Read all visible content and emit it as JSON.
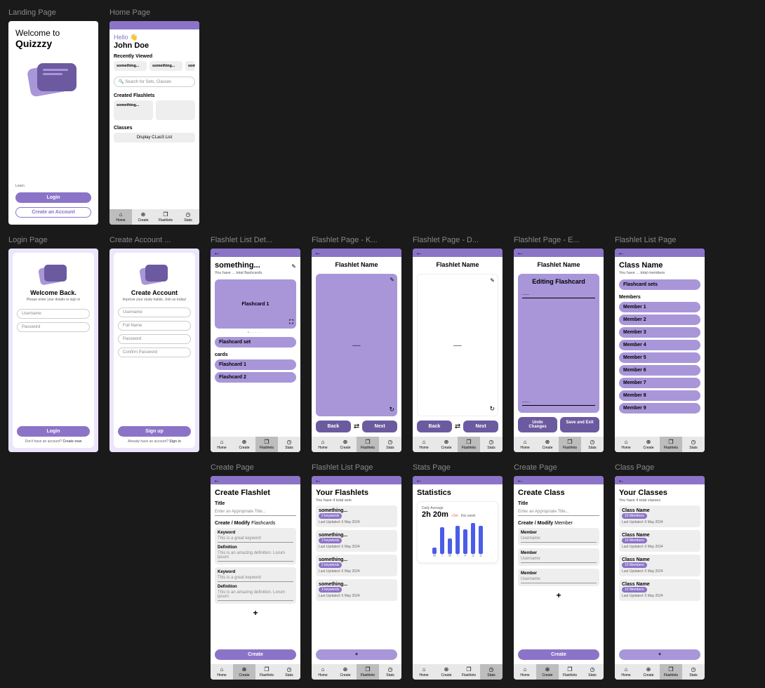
{
  "nav": {
    "home": "Home",
    "create": "Create",
    "flashlets": "Flashlets",
    "stats": "Stats"
  },
  "landing": {
    "label": "Landing Page",
    "welcome_to": "Welcome to",
    "brand": "Quizzzy",
    "login": "Login",
    "create_account": "Create an Account",
    "footnote": "Learn"
  },
  "home": {
    "label": "Home Page",
    "hello": "Hello 👋",
    "username": "John Doe",
    "recently_viewed": "Recently Viewed",
    "items": [
      "something...",
      "something...",
      "som"
    ],
    "search_placeholder": "Search for Sets, Classes",
    "created_flashlets": "Created Flashlets",
    "flashlet": "something...",
    "classes": "Classes",
    "display_class": "Display CLasS List"
  },
  "create_flashlet": {
    "label": "Create Page",
    "title": "Create Flashlet",
    "title_field": "Title",
    "title_placeholder": "Enter an Appropriate Title...",
    "section": "Create / Modify",
    "section_suffix": "Flashcards",
    "keyword": "Keyword",
    "keyword_val": "This is a great keyword",
    "definition": "Definition",
    "definition_val": "This is an amazing definition. Lorum ipsum",
    "create": "Create"
  },
  "flashlet_list": {
    "label": "Flashlet List Page",
    "title": "Your Flashlets",
    "subtitle": "You have 4 total sets",
    "item_name": "something...",
    "keyword_badge": "2 keywords",
    "updated": "Last Updated: 6 May 2024"
  },
  "stats": {
    "label": "Stats Page",
    "title": "Statistics",
    "avg_label": "Daily Average",
    "avg_value": "2h 20m",
    "delta": "+3m",
    "delta_label": "this week",
    "days": [
      "M",
      "T",
      "W",
      "T",
      "F",
      "S",
      "S"
    ],
    "chart_data": {
      "type": "bar",
      "categories": [
        "M",
        "T",
        "W",
        "T",
        "F",
        "S",
        "S"
      ],
      "values": [
        15,
        38,
        22,
        40,
        35,
        44,
        40
      ],
      "ylim": [
        0,
        50
      ],
      "title": "Daily Average"
    }
  },
  "create_class": {
    "label": "Create Page",
    "title": "Create Class",
    "title_field": "Title",
    "title_placeholder": "Enter an Appropriate Title...",
    "section": "Create / Modify",
    "section_suffix": "Member",
    "member": "Member",
    "member_placeholder": "Username",
    "create": "Create"
  },
  "class_page": {
    "label": "Class Page",
    "title": "Your Classes",
    "subtitle": "You have 4 total classes",
    "class_name": "Class Name",
    "members": "10 Members",
    "updated": "Last Updated: 6 May 2024"
  },
  "login_page": {
    "label": "Login Page",
    "title": "Welcome Back.",
    "subtitle": "Please enter your details to sign in",
    "username": "Username",
    "password": "Password",
    "login": "Login",
    "no_account": "Don't have an account?",
    "create_now": "Create now"
  },
  "create_account": {
    "label": "Create Account ...",
    "title": "Create Account",
    "subtitle": "Improve your study habits. Join us today!",
    "username": "Username",
    "fullname": "Full Name",
    "password": "Password",
    "confirm": "Confirm Password",
    "signup": "Sign up",
    "have_account": "Already have an account?",
    "signin": "Sign in"
  },
  "flashlet_detail": {
    "label": "Flashlet List Det...",
    "title": "something...",
    "subtitle": "You have ... total flashcards",
    "card": "Flashcard 1",
    "set": "Flashcard set",
    "cards_label": "cards",
    "card1": "Flashcard 1",
    "card2": "Flashcard 2"
  },
  "flashlet_page_k": {
    "label": "Flashlet Page - K...",
    "title": "Flashlet Name",
    "dots": "......",
    "back": "Back",
    "next": "Next"
  },
  "flashlet_page_d": {
    "label": "Flashlet Page - D...",
    "title": "Flashlet Name",
    "dots": "......",
    "back": "Back",
    "next": "Next"
  },
  "flashlet_page_e": {
    "label": "Flashlet Page - E...",
    "title": "Flashlet Name",
    "editing": "Editing Flashcard",
    "dots": "......",
    "undo": "Undo Changes",
    "save": "Save and Exit"
  },
  "class_list": {
    "label": "Flashlet List Page",
    "title": "Class Name",
    "subtitle": "You have ... total members",
    "sets": "Flashcard sets",
    "members": "Members",
    "member_prefix": "Member "
  }
}
